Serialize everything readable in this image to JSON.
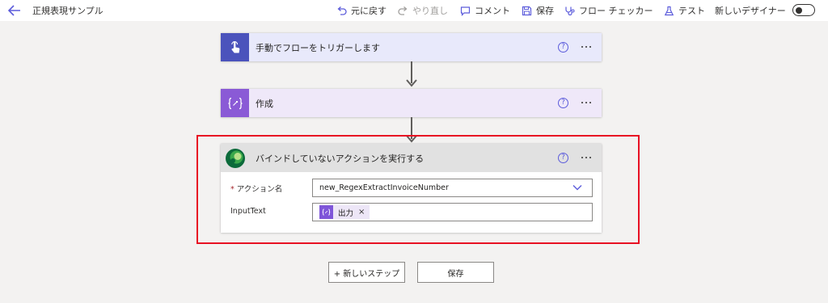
{
  "header": {
    "title": "正規表現サンプル",
    "back_icon": "arrow-left-icon",
    "toolbar": [
      {
        "label": "元に戻す",
        "icon": "undo-icon",
        "enabled": true
      },
      {
        "label": "やり直し",
        "icon": "redo-icon",
        "enabled": false
      },
      {
        "label": "コメント",
        "icon": "comment-icon",
        "enabled": true
      },
      {
        "label": "保存",
        "icon": "save-icon",
        "enabled": true
      },
      {
        "label": "フロー チェッカー",
        "icon": "stethoscope-icon",
        "enabled": true
      },
      {
        "label": "テスト",
        "icon": "flask-icon",
        "enabled": true
      }
    ],
    "new_designer": {
      "label": "新しいデザイナー",
      "on": false
    }
  },
  "steps": [
    {
      "title": "手動でフローをトリガーします",
      "icon": "touch-hand-icon",
      "color": "#4b53bc",
      "header_bg": "#e8e9fb"
    },
    {
      "title": "作成",
      "icon": "compose-expression-icon",
      "color": "#8a5ad6",
      "header_bg": "#efe8f9"
    },
    {
      "title": "バインドしていないアクションを実行する",
      "icon": "dataverse-icon",
      "header_bg": "#e1e1e1",
      "fields": {
        "action_name": {
          "label": "アクション名",
          "required_mark": "*",
          "value": "new_RegexExtractInvoiceNumber"
        },
        "input_text": {
          "label": "InputText",
          "token": "出力",
          "token_icon": "compose-expression-icon",
          "remove_glyph": "×"
        }
      }
    }
  ],
  "help_glyph": "?",
  "highlight_color": "#e81123",
  "footer": {
    "new_step_label": "+ 新しいステップ",
    "save_label": "保存"
  }
}
